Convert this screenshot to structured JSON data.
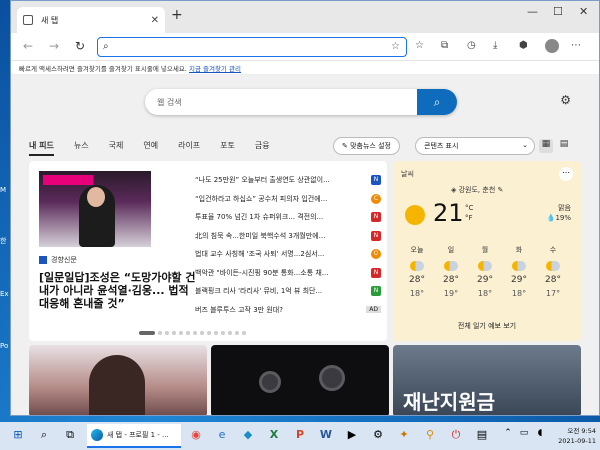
{
  "desktop": {
    "labels": [
      "M",
      "Ex",
      "Po",
      "한"
    ]
  },
  "browser": {
    "tab_title": "새 탭",
    "favbar_text": "빠르게 액세스하려면 즐겨찾기를 즐겨찾기 표시줄에 넣으세요.",
    "favbar_link": "지금 즐겨찾기 관리"
  },
  "page": {
    "search_placeholder": "웹 검색",
    "categories": [
      "내 피드",
      "뉴스",
      "국제",
      "연예",
      "라이프",
      "포토",
      "금융"
    ],
    "personalize_label": "맞춤뉴스 설정",
    "content_visibility_label": "콘텐츠 표시"
  },
  "hero": {
    "source": "경향신문",
    "title": "[일문일답]조성은 “도망가야할 건 내가 아니라 윤석열·김웅... 법적 대응해 혼내줄 것”"
  },
  "headlines": [
    {
      "text": "“나도 25만원” 오늘부터 출생연도 상관없이...",
      "badge": "N",
      "color": "#1a55c0"
    },
    {
      "text": "“입건하라고 하십쇼” 공수처 피의자 입건에...",
      "badge": "C",
      "color": "#f08a00"
    },
    {
      "text": "투표율 70% 넘긴 1차 슈퍼위크... 격전의...",
      "badge": "N",
      "color": "#d62828"
    },
    {
      "text": "北의 침묵 속...한미일 북핵수석 3개월만에...",
      "badge": "N",
      "color": "#d62828"
    },
    {
      "text": "법대 교수 사칭해 '조국 사퇴' 서명...2심서...",
      "badge": "O",
      "color": "#f08a00"
    },
    {
      "text": "백악관 \"바이든-시진핑 90분 통화...소통 채...",
      "badge": "N",
      "color": "#d62828"
    },
    {
      "text": "블랙핑크 리사 '라리사' 뮤비, 1억 뷰 최단...",
      "badge": "N",
      "color": "#2a9d3a"
    },
    {
      "text": "버즈 블루투스 고작 3만 원대?",
      "badge": "AD",
      "color": "#888888"
    }
  ],
  "weather": {
    "title": "날씨",
    "location": "강원도, 춘천",
    "temp": "21",
    "unit_c": "°C",
    "unit_f": "°F",
    "condition": "맑음",
    "precip": "19%",
    "forecast": [
      {
        "day": "오늘",
        "hi": "28°",
        "lo": "18°"
      },
      {
        "day": "일",
        "hi": "28°",
        "lo": "19°"
      },
      {
        "day": "월",
        "hi": "29°",
        "lo": "18°"
      },
      {
        "day": "화",
        "hi": "29°",
        "lo": "18°"
      },
      {
        "day": "수",
        "hi": "28°",
        "lo": "17°"
      }
    ],
    "link": "전체 일기 예보 보기"
  },
  "cards": {
    "third_caption": "재난지원금"
  },
  "taskbar": {
    "active_app": "새 탭 - 프로필 1 - ...",
    "time": "오전 9:54",
    "date": "2021-09-11"
  }
}
